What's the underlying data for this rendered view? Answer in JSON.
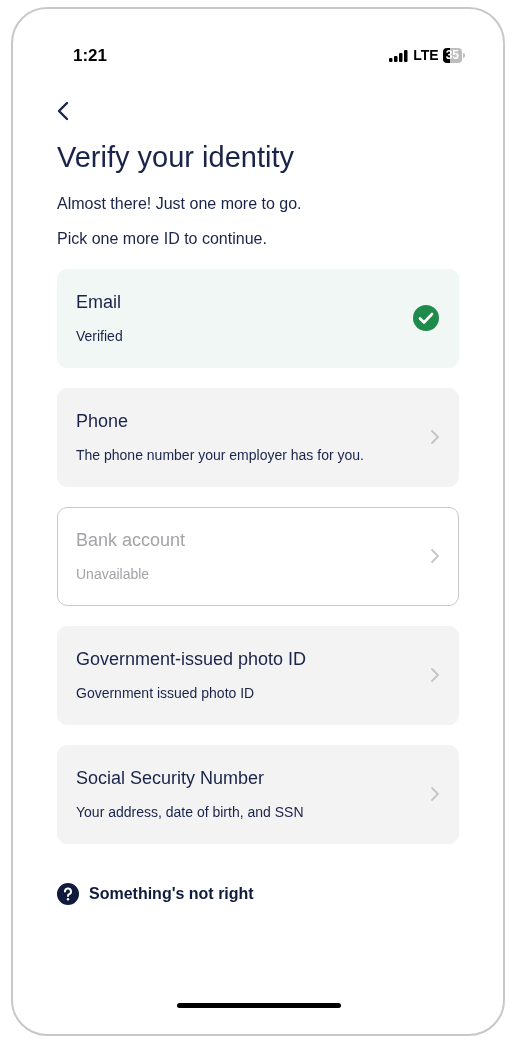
{
  "status_bar": {
    "time": "1:21",
    "network": "LTE",
    "battery": "35"
  },
  "title": "Verify your identity",
  "intro": [
    "Almost there! Just one more to go.",
    "Pick one more ID to continue."
  ],
  "options": [
    {
      "title": "Email",
      "subtitle": "Verified",
      "kind": "verified"
    },
    {
      "title": "Phone",
      "subtitle": "The phone number your employer has for you.",
      "kind": "available"
    },
    {
      "title": "Bank account",
      "subtitle": "Unavailable",
      "kind": "unavailable"
    },
    {
      "title": "Government-issued photo ID",
      "subtitle": "Government issued photo ID",
      "kind": "available"
    },
    {
      "title": "Social Security Number",
      "subtitle": "Your address, date of birth, and SSN",
      "kind": "available"
    }
  ],
  "help_link": "Something's not right"
}
